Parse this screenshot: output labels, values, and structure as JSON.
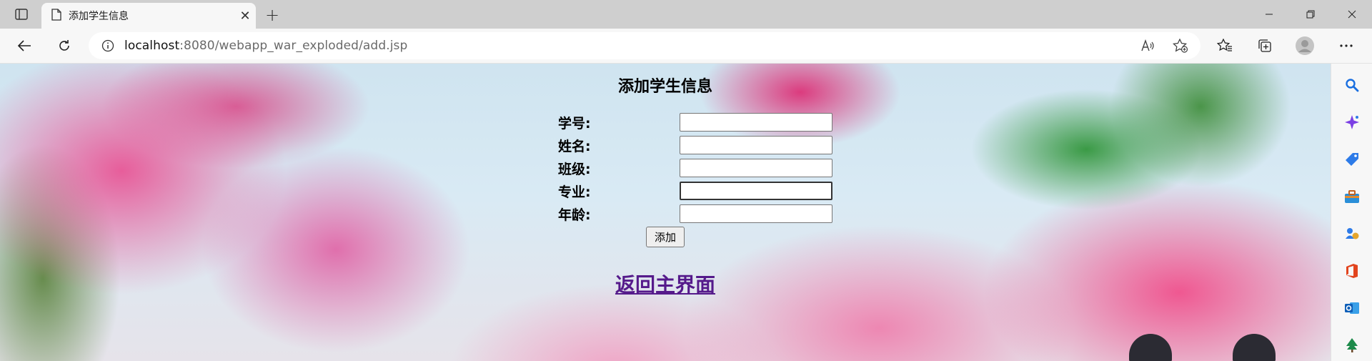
{
  "browser": {
    "tab": {
      "title": "添加学生信息"
    },
    "address_bar": {
      "host": "localhost",
      "path": ":8080/webapp_war_exploded/add.jsp"
    }
  },
  "page": {
    "title": "添加学生信息",
    "form": {
      "fields": [
        {
          "label": "学号:",
          "value": ""
        },
        {
          "label": "姓名:",
          "value": ""
        },
        {
          "label": "班级:",
          "value": ""
        },
        {
          "label": "专业:",
          "value": ""
        },
        {
          "label": "年龄:",
          "value": ""
        }
      ],
      "submit_label": "添加"
    },
    "back_link": "返回主界面"
  },
  "colors": {
    "link_visited": "#551a8b",
    "chrome_bg": "#f7f7f7",
    "tabstrip_bg": "#cfcfcf"
  },
  "icons": {
    "sidebar": [
      "search-icon",
      "copilot-icon",
      "shopping-tag-icon",
      "tools-icon",
      "games-icon",
      "office-icon",
      "outlook-icon",
      "tree-icon"
    ]
  }
}
